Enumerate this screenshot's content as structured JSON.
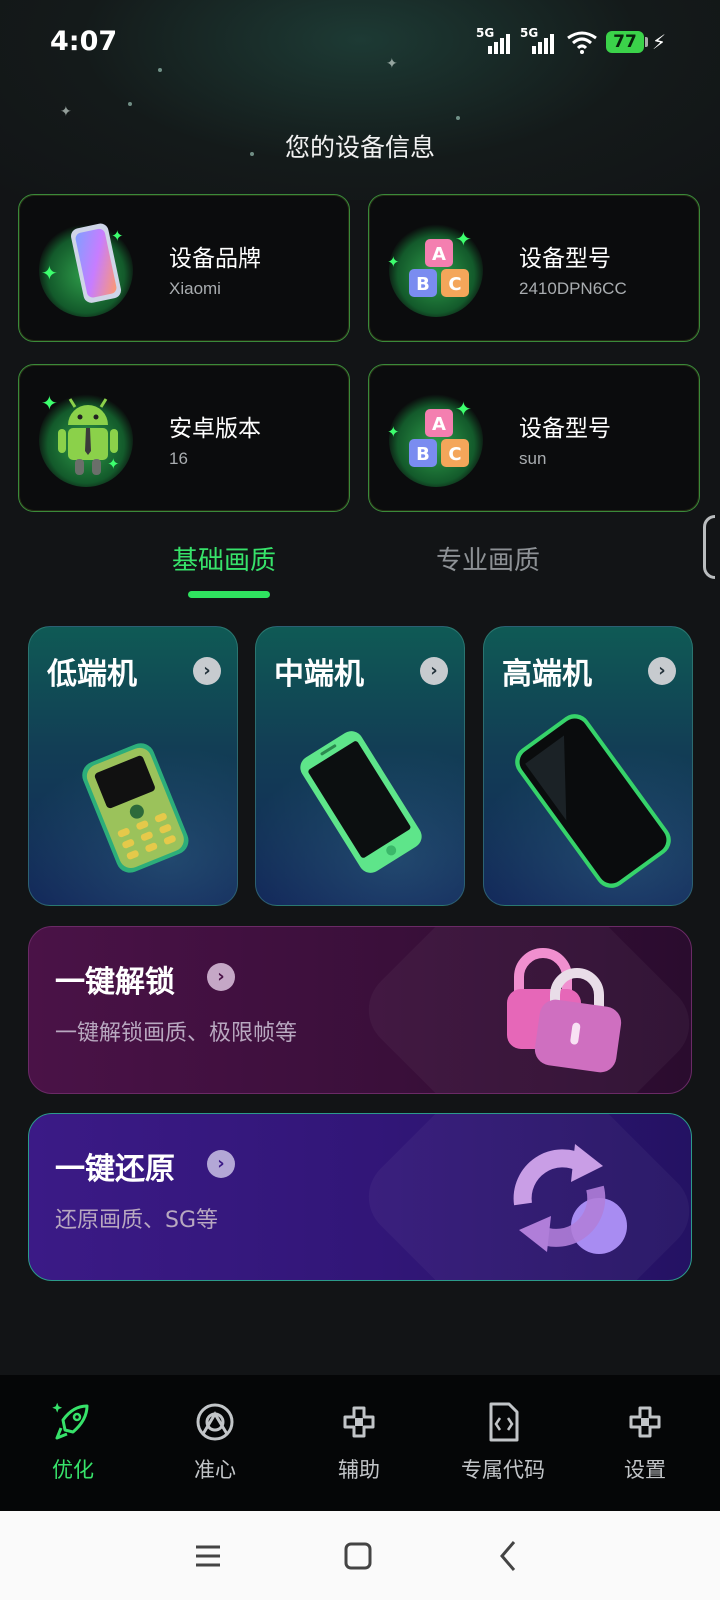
{
  "status_bar": {
    "time": "4:07",
    "network_1": "5G",
    "network_2": "5G",
    "battery": "77"
  },
  "page_title": "您的设备信息",
  "device_cards": [
    {
      "label": "设备品牌",
      "value": "Xiaomi",
      "icon": "phone-icon"
    },
    {
      "label": "设备型号",
      "value": "2410DPN6CC",
      "icon": "abc-blocks-icon"
    },
    {
      "label": "安卓版本",
      "value": "16",
      "icon": "android-icon"
    },
    {
      "label": "设备型号",
      "value": "sun",
      "icon": "abc-blocks-icon"
    }
  ],
  "tabs": [
    {
      "label": "基础画质",
      "active": true
    },
    {
      "label": "专业画质",
      "active": false
    }
  ],
  "tiers": [
    {
      "title": "低端机",
      "icon": "feature-phone-icon"
    },
    {
      "title": "中端机",
      "icon": "smartphone-icon"
    },
    {
      "title": "高端机",
      "icon": "smartphone-icon"
    }
  ],
  "actions": [
    {
      "title": "一键解锁",
      "desc": "一键解锁画质、极限帧等",
      "icon": "padlock-icon"
    },
    {
      "title": "一键还原",
      "desc": "还原画质、SG等",
      "icon": "restore-icon"
    }
  ],
  "bottom_nav": [
    {
      "label": "优化",
      "icon": "rocket-icon",
      "active": true
    },
    {
      "label": "准心",
      "icon": "crosshair-icon",
      "active": false
    },
    {
      "label": "辅助",
      "icon": "assist-icon",
      "active": false
    },
    {
      "label": "专属代码",
      "icon": "code-file-icon",
      "active": false
    },
    {
      "label": "设置",
      "icon": "settings-icon",
      "active": false
    }
  ],
  "colors": {
    "accent": "#37e26a",
    "background": "#121416",
    "card_border": "#3a8a3a",
    "unlock_card": "#4a1247",
    "restore_card": "#3b1a86"
  }
}
